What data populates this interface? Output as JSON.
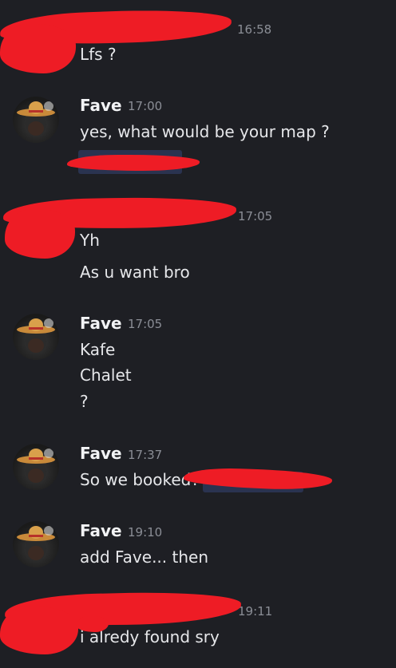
{
  "messages": [
    {
      "type": "continued",
      "time": "16:58",
      "lines": [
        "Lfs ?"
      ]
    },
    {
      "type": "group",
      "author": "Fave",
      "time": "17:00",
      "lines": [
        "yes, what would be your map ?"
      ]
    },
    {
      "type": "continued",
      "time": "17:05",
      "lines": [
        "Yh",
        "As u want bro"
      ]
    },
    {
      "type": "group",
      "author": "Fave",
      "time": "17:05",
      "lines": [
        "Kafe",
        "Chalet",
        "?"
      ]
    },
    {
      "type": "group",
      "author": "Fave",
      "time": "17:37",
      "lines": [
        "So we booked?"
      ]
    },
    {
      "type": "group",
      "author": "Fave",
      "time": "19:10",
      "lines": [
        "add Fave... then"
      ]
    },
    {
      "type": "continued",
      "time": "19:11",
      "lines": [
        "i alredy found sry"
      ]
    }
  ],
  "colors": {
    "background": "#1e1f24",
    "text": "#e6e7ea",
    "timestamp": "#8b8e96",
    "redaction": "#ee1c25"
  },
  "icons": {
    "avatar": "sombrero-avatar-icon"
  }
}
